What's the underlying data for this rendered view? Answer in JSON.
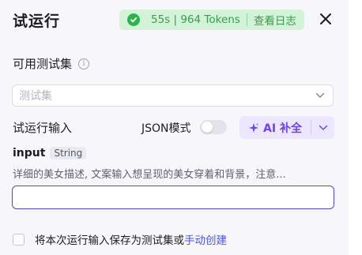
{
  "header": {
    "title": "试运行",
    "status": {
      "metrics": "55s | 964 Tokens",
      "log_link": "查看日志",
      "color": "#2fb14b"
    },
    "close_icon": "close-icon"
  },
  "test_set": {
    "label": "可用测试集",
    "info_icon": "i",
    "placeholder": "测试集"
  },
  "trial_input": {
    "label": "试运行输入",
    "json_mode_label": "JSON模式",
    "json_mode_on": false,
    "ai_button_label": "AI 补全"
  },
  "field": {
    "name": "input",
    "type": "String",
    "description": "详细的美女描述, 文案输入想呈现的美女穿着和背景，注意...",
    "value": ""
  },
  "footer": {
    "save_text": "将本次运行输入保存为测试集或",
    "manual_link": "手动创建",
    "checked": false
  },
  "colors": {
    "accent": "#4d53e8",
    "ai_purple": "#6f43f0",
    "success_bg": "#d2f3d8"
  }
}
